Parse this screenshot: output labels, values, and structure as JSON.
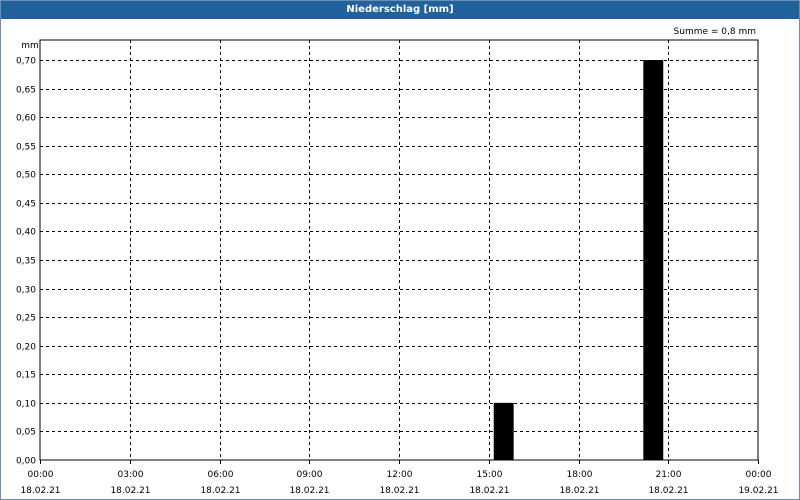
{
  "window": {
    "title": "Niederschlag [mm]"
  },
  "chart_data": {
    "type": "bar",
    "title": "Niederschlag [mm]",
    "ylabel": "mm",
    "ylim": [
      0,
      0.7
    ],
    "yticks": [
      "0,00",
      "0,05",
      "0,10",
      "0,15",
      "0,20",
      "0,25",
      "0,30",
      "0,35",
      "0,40",
      "0,45",
      "0,50",
      "0,55",
      "0,60",
      "0,65",
      "0,70"
    ],
    "xrange_hours": [
      0,
      24
    ],
    "xticks": [
      {
        "time": "00:00",
        "date": "18.02.21"
      },
      {
        "time": "03:00",
        "date": "18.02.21"
      },
      {
        "time": "06:00",
        "date": "18.02.21"
      },
      {
        "time": "09:00",
        "date": "18.02.21"
      },
      {
        "time": "12:00",
        "date": "18.02.21"
      },
      {
        "time": "15:00",
        "date": "18.02.21"
      },
      {
        "time": "18:00",
        "date": "18.02.21"
      },
      {
        "time": "21:00",
        "date": "18.02.21"
      },
      {
        "time": "00:00",
        "date": "19.02.21"
      }
    ],
    "bars": [
      {
        "start": "18.02.21 15:10",
        "end": "18.02.21 15:50",
        "value": 0.1
      },
      {
        "start": "18.02.21 20:10",
        "end": "18.02.21 20:50",
        "value": 0.7
      }
    ],
    "annotation": "Summe = 0,8 mm",
    "grid": true,
    "bar_color": "#000000"
  }
}
